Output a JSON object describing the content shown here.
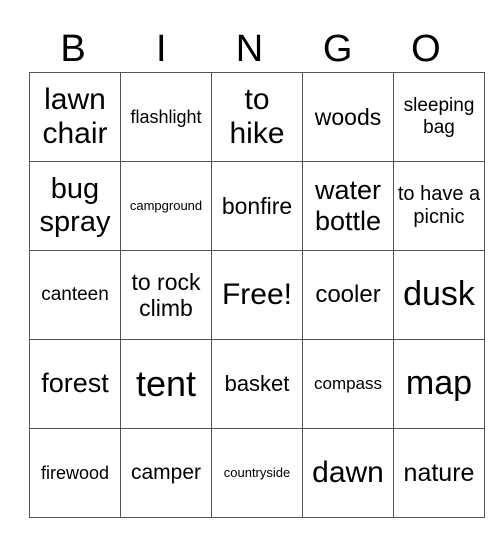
{
  "header": [
    "B",
    "I",
    "N",
    "G",
    "O"
  ],
  "cells": [
    [
      {
        "text": "lawn chair",
        "size": 30
      },
      {
        "text": "flashlight",
        "size": 18
      },
      {
        "text": "to hike",
        "size": 30
      },
      {
        "text": "woods",
        "size": 23
      },
      {
        "text": "sleeping bag",
        "size": 19
      }
    ],
    [
      {
        "text": "bug spray",
        "size": 29
      },
      {
        "text": "campground",
        "size": 13
      },
      {
        "text": "bonfire",
        "size": 23
      },
      {
        "text": "water bottle",
        "size": 27
      },
      {
        "text": "to have a picnic",
        "size": 20
      }
    ],
    [
      {
        "text": "canteen",
        "size": 19
      },
      {
        "text": "to rock climb",
        "size": 23
      },
      {
        "text": "Free!",
        "size": 30
      },
      {
        "text": "cooler",
        "size": 24
      },
      {
        "text": "dusk",
        "size": 34
      }
    ],
    [
      {
        "text": "forest",
        "size": 27
      },
      {
        "text": "tent",
        "size": 36
      },
      {
        "text": "basket",
        "size": 22
      },
      {
        "text": "compass",
        "size": 17
      },
      {
        "text": "map",
        "size": 34
      }
    ],
    [
      {
        "text": "firewood",
        "size": 18
      },
      {
        "text": "camper",
        "size": 21
      },
      {
        "text": "countryside",
        "size": 13
      },
      {
        "text": "dawn",
        "size": 30
      },
      {
        "text": "nature",
        "size": 25
      }
    ]
  ]
}
